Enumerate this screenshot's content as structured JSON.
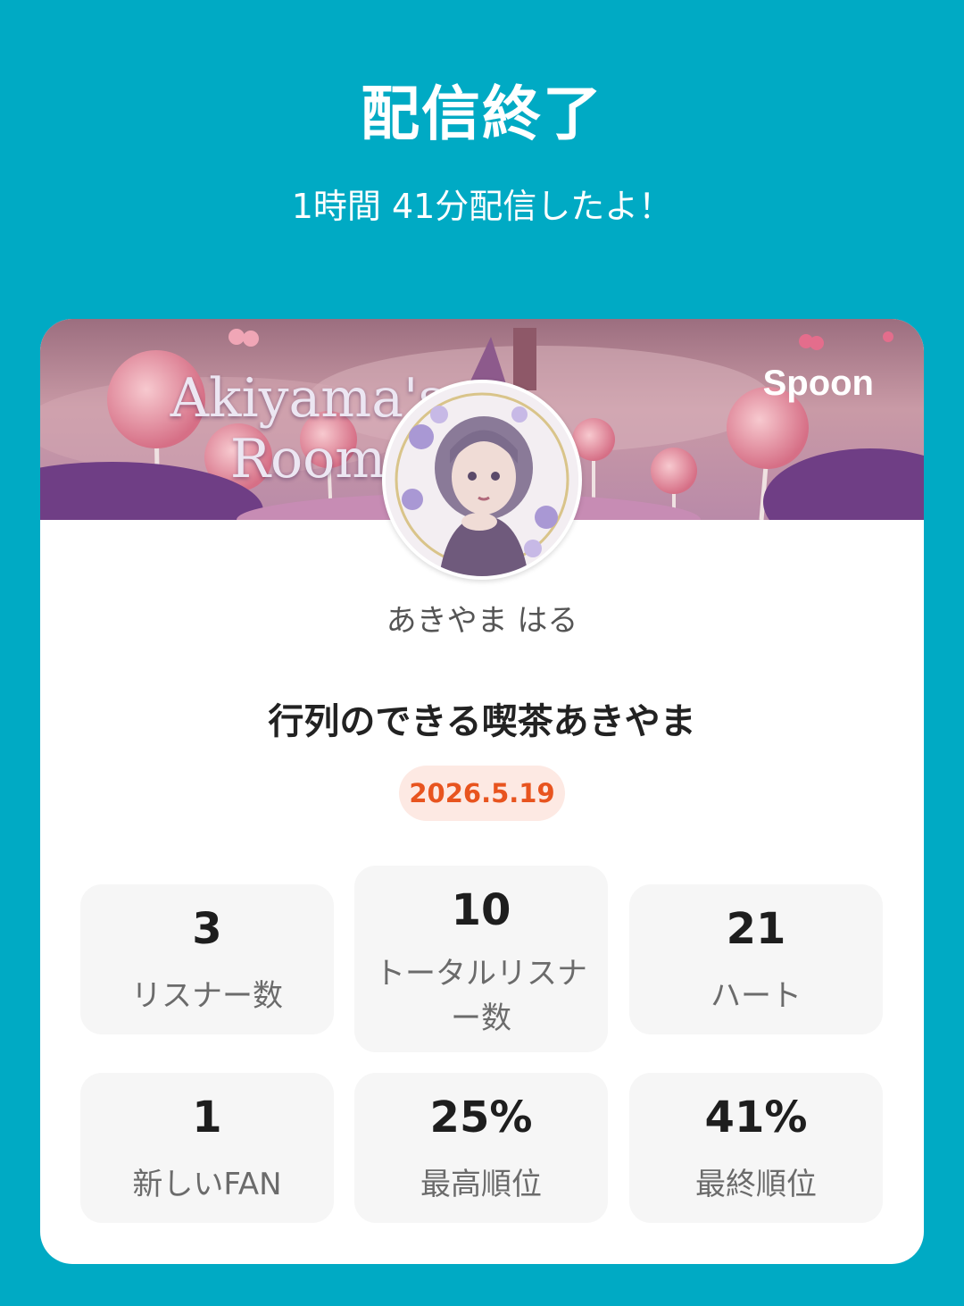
{
  "header": {
    "title": "配信終了",
    "subtitle": "1時間 41分配信したよ！"
  },
  "banner": {
    "room_title_line1": "Akiyama's",
    "room_title_line2": "Room",
    "brand": "Spoon"
  },
  "profile": {
    "username": "あきやま はる"
  },
  "broadcast": {
    "title": "行列のできる喫茶あきやま",
    "date": "2026.5.19"
  },
  "stats": [
    {
      "value": "3",
      "label": "リスナー数"
    },
    {
      "value": "10",
      "label_line1": "トータルリスナ",
      "label_line2": "ー数"
    },
    {
      "value": "21",
      "label": "ハート"
    },
    {
      "value": "1",
      "label": "新しいFAN"
    },
    {
      "value": "25%",
      "label": "最高順位"
    },
    {
      "value": "41%",
      "label": "最終順位"
    }
  ],
  "colors": {
    "background": "#00aac4",
    "date_badge_text": "#e8541f",
    "date_badge_bg": "#fde9e3"
  }
}
